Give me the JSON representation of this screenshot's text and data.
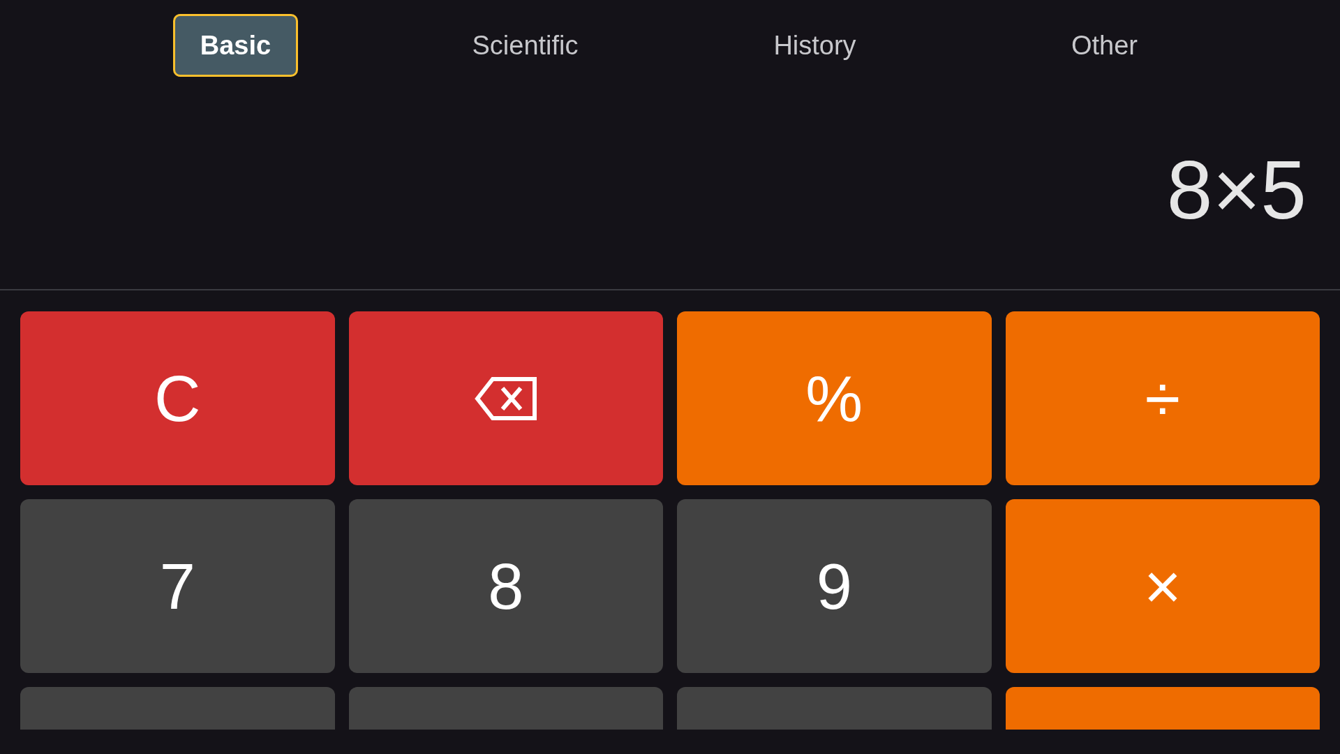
{
  "tabs": [
    {
      "label": "Basic",
      "selected": true
    },
    {
      "label": "Scientific",
      "selected": false
    },
    {
      "label": "History",
      "selected": false
    },
    {
      "label": "Other",
      "selected": false
    }
  ],
  "display": {
    "expression": "8×5"
  },
  "keys": [
    {
      "kind": "clear",
      "label": "C"
    },
    {
      "kind": "backspace"
    },
    {
      "kind": "operator",
      "label": "%"
    },
    {
      "kind": "operator",
      "label": "÷"
    },
    {
      "kind": "digit",
      "label": "7"
    },
    {
      "kind": "digit",
      "label": "8"
    },
    {
      "kind": "digit",
      "label": "9"
    },
    {
      "kind": "operator",
      "label": "×"
    }
  ],
  "partial_keys": [
    {
      "kind": "digit"
    },
    {
      "kind": "digit"
    },
    {
      "kind": "digit"
    },
    {
      "kind": "operator"
    }
  ]
}
